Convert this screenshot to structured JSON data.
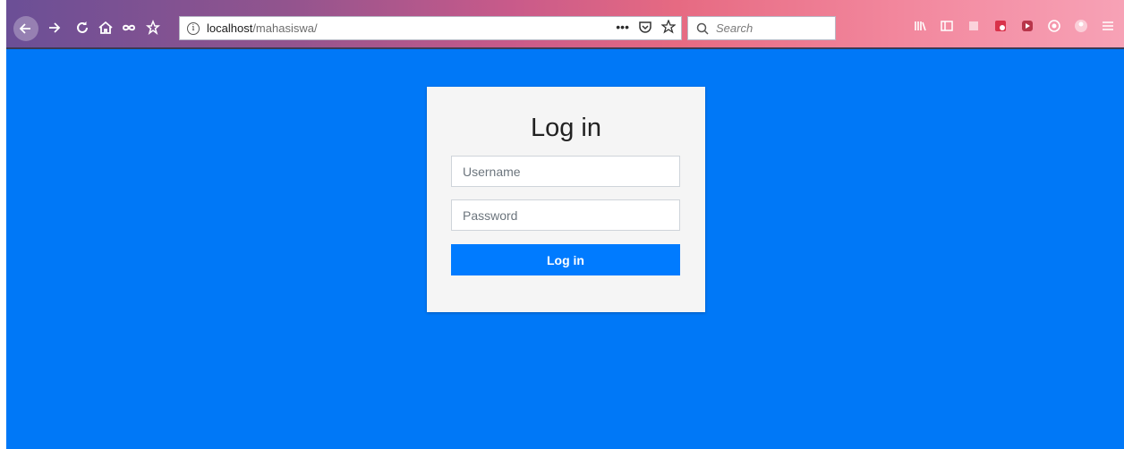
{
  "browser": {
    "url_host": "localhost",
    "url_path": "/mahasiswa/",
    "page_actions_icon": "ellipsis-icon",
    "search_placeholder": "Search",
    "nav_icons": [
      "back-arrow-icon",
      "forward-arrow-icon",
      "reload-icon",
      "home-icon",
      "infinity-icon",
      "bookmark-star-icon"
    ],
    "right_icons": [
      "library-icon",
      "sidebar-icon",
      "extension-icon",
      "pdf-icon",
      "media-icon",
      "circle-icon",
      "account-icon",
      "menu-icon"
    ]
  },
  "login": {
    "title": "Log in",
    "username_placeholder": "Username",
    "password_placeholder": "Password",
    "button_label": "Log in"
  },
  "colors": {
    "page_background": "#0078f7",
    "card_background": "#f5f5f5",
    "button_background": "#007bff"
  }
}
